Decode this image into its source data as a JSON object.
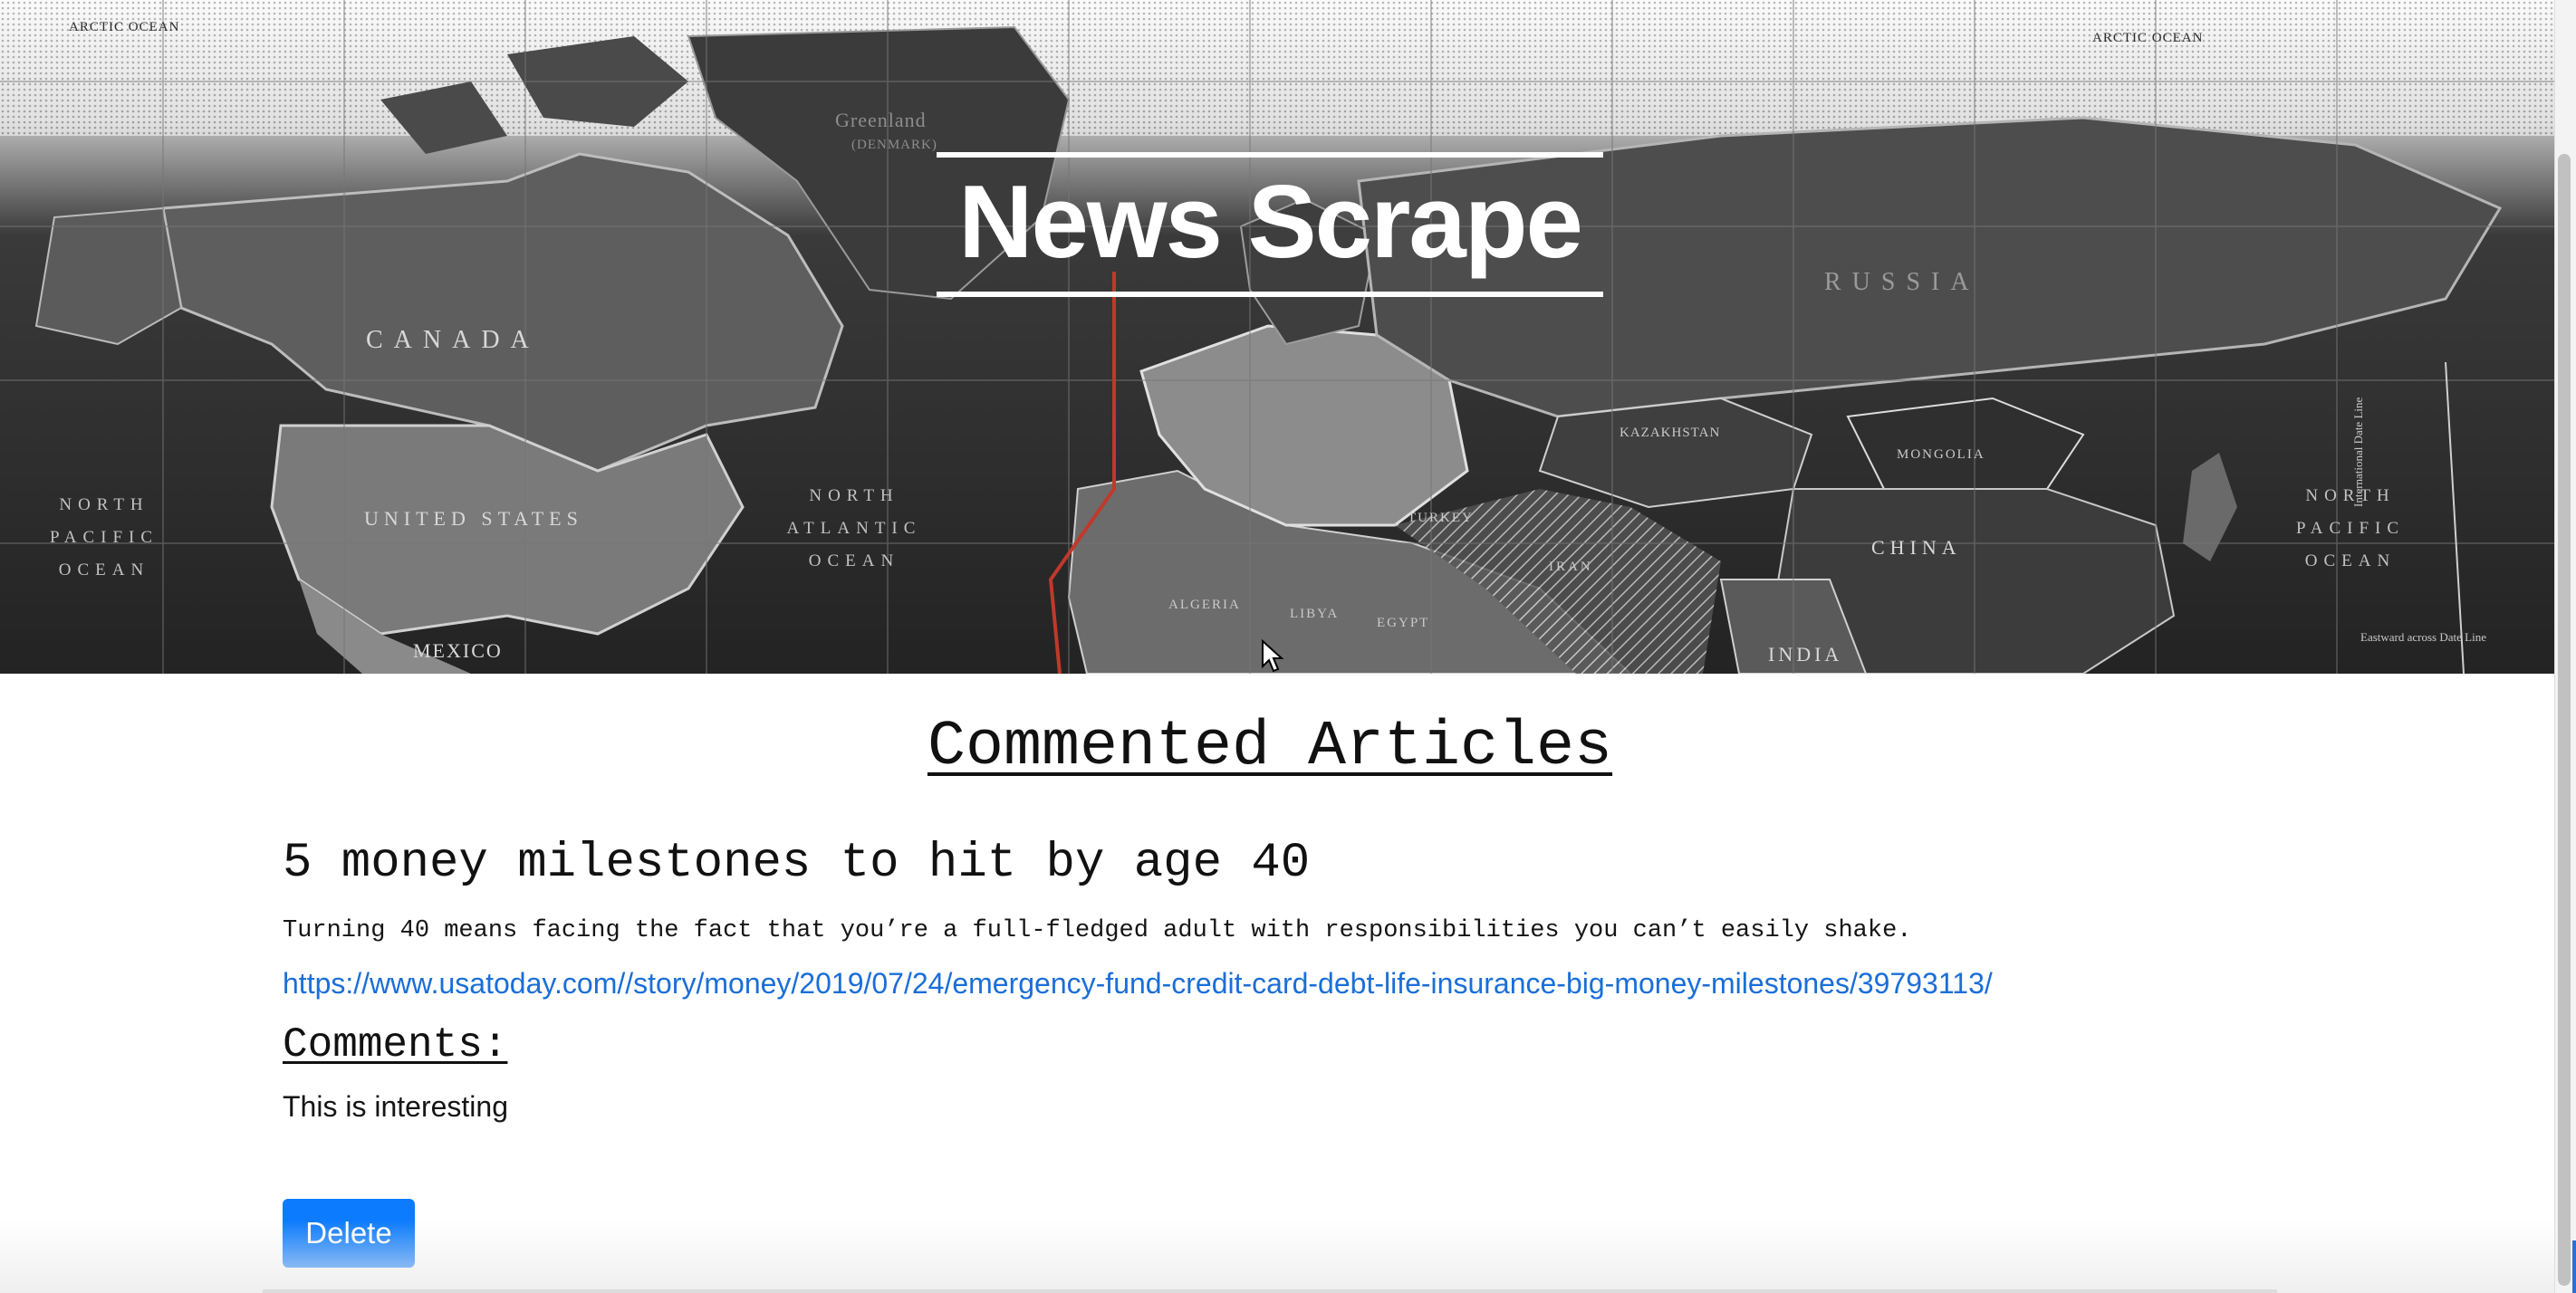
{
  "header": {
    "site_title": "News Scrape",
    "map_labels": {
      "arctic_left": "ARCTIC OCEAN",
      "arctic_right": "ARCTIC OCEAN",
      "greenland": "Greenland",
      "greenland_sub": "(DENMARK)",
      "canada": "CANADA",
      "united_states": "UNITED STATES",
      "mexico": "MEXICO",
      "russia": "RUSSIA",
      "kazakhstan": "KAZAKHSTAN",
      "mongolia": "MONGOLIA",
      "china": "CHINA",
      "india": "INDIA",
      "algeria": "ALGERIA",
      "libya": "LIBYA",
      "egypt": "EGYPT",
      "turkey": "TURKEY",
      "iran": "IRAN",
      "north_pacific_left": [
        "NORTH",
        "PACIFIC",
        "OCEAN"
      ],
      "north_atlantic": [
        "NORTH",
        "ATLANTIC",
        "OCEAN"
      ],
      "north_pacific_right": [
        "NORTH",
        "PACIFIC",
        "OCEAN"
      ],
      "date_line": "International Date Line",
      "eastward": "Eastward across Date Line"
    }
  },
  "main": {
    "section_title": "Commented Articles",
    "articles": [
      {
        "headline": "5 money milestones to hit by age 40",
        "summary": "Turning 40 means facing the fact that you’re a full-fledged adult with responsibilities you can’t easily shake.",
        "link": "https://www.usatoday.com//story/money/2019/07/24/emergency-fund-credit-card-debt-life-insurance-big-money-milestones/39793113/",
        "comments_heading": "Comments:",
        "comment": "This is interesting",
        "delete_label": "Delete"
      }
    ]
  },
  "colors": {
    "link": "#1a6ed8",
    "button": "#0d7bfd",
    "map_dark": "#262626"
  }
}
